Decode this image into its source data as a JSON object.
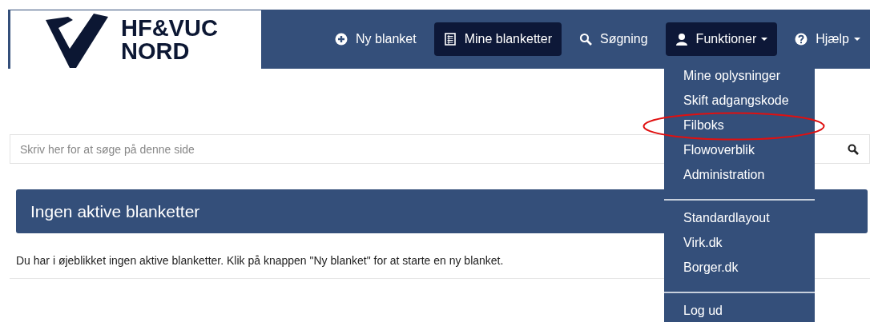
{
  "logo": {
    "lines": [
      "HF&VUC",
      "NORD"
    ]
  },
  "nav": [
    {
      "label": "Ny blanket",
      "kind": "add",
      "selected": false,
      "dropdown": false
    },
    {
      "label": "Mine blanketter",
      "kind": "list",
      "selected": true,
      "dropdown": false
    },
    {
      "label": "Søgning",
      "kind": "search",
      "selected": false,
      "dropdown": false
    },
    {
      "label": "Funktioner",
      "kind": "user",
      "selected": true,
      "dropdown": true
    },
    {
      "label": "Hjælp",
      "kind": "help",
      "selected": false,
      "dropdown": true
    }
  ],
  "dropdown_menu": {
    "groups": [
      [
        {
          "label": "Mine oplysninger",
          "highlighted": false
        },
        {
          "label": "Skift adgangskode",
          "highlighted": false
        },
        {
          "label": "Filboks",
          "highlighted": true
        },
        {
          "label": "Flowoverblik",
          "highlighted": false
        },
        {
          "label": "Administration",
          "highlighted": false
        }
      ],
      [
        {
          "label": "Standardlayout",
          "highlighted": false
        },
        {
          "label": "Virk.dk",
          "highlighted": false
        },
        {
          "label": "Borger.dk",
          "highlighted": false
        }
      ],
      [
        {
          "label": "Log ud",
          "highlighted": false
        }
      ]
    ]
  },
  "search": {
    "placeholder": "Skriv her for at søge på denne side"
  },
  "panel": {
    "title": "Ingen aktive blanketter",
    "message": "Du har i øjeblikket ingen aktive blanketter. Klik på knappen \"Ny blanket\" for at starte en ny blanket."
  }
}
